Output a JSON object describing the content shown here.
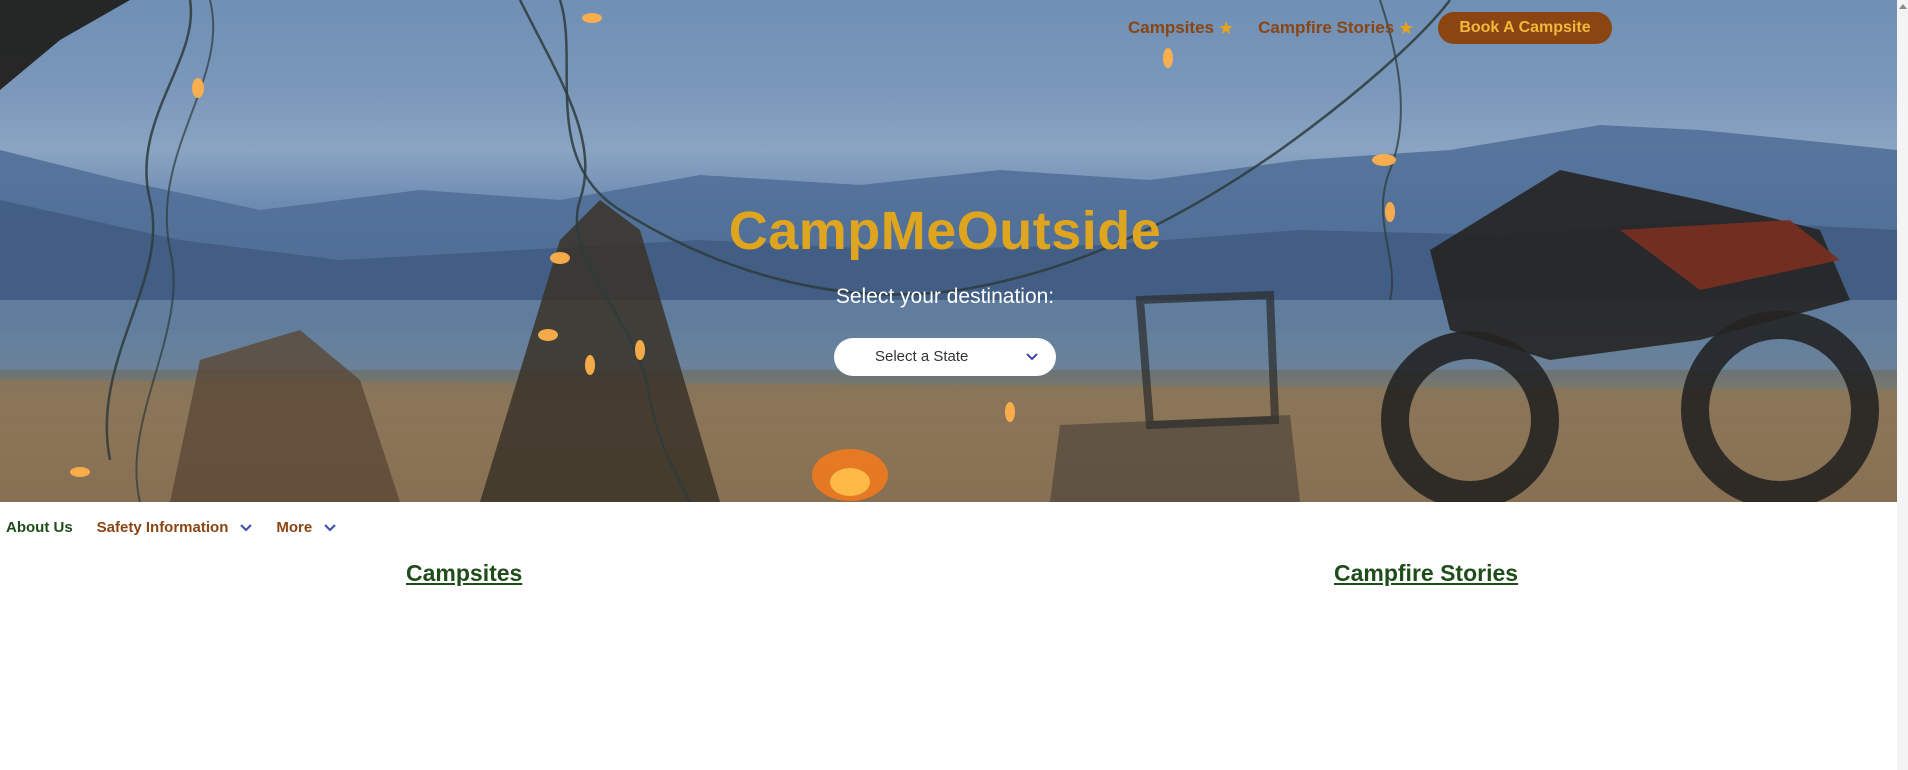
{
  "top_nav": {
    "campsites_label": "Campsites",
    "campfire_stories_label": "Campfire Stories",
    "book_button_label": "Book A Campsite",
    "star_icon": "star-icon"
  },
  "hero": {
    "title": "CampMeOutside",
    "subtitle": "Select your destination:",
    "state_select": {
      "selected": "Select a State"
    }
  },
  "sub_nav": {
    "about_label": "About Us",
    "safety_label": "Safety Information",
    "more_label": "More"
  },
  "sections": {
    "campsites_heading": "Campsites",
    "campfire_stories_heading": "Campfire Stories"
  },
  "colors": {
    "brand_brown": "#8b4513",
    "brand_gold": "#e0a51f",
    "brand_green": "#1f4d1a",
    "chevron_blue": "#3a4aa8"
  }
}
